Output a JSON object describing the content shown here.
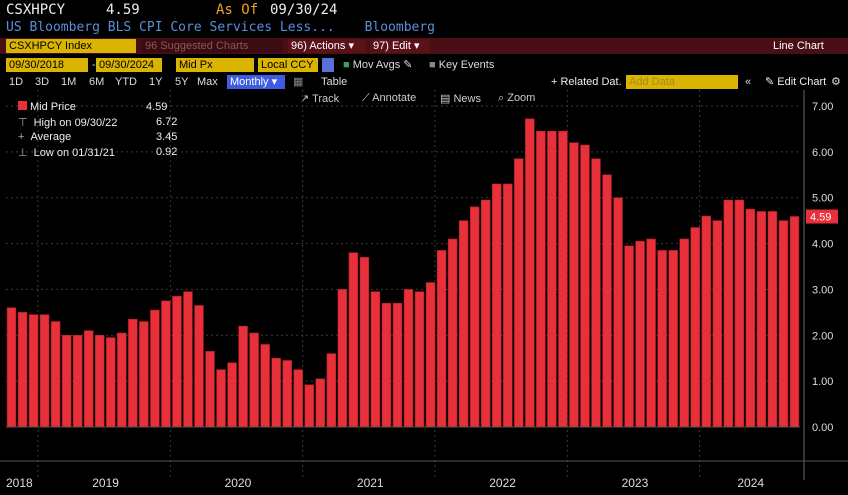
{
  "header": {
    "ticker": "CSXHPCY",
    "last_value": "4.59",
    "as_of_label": "As Of",
    "as_of_date": "09/30/24",
    "description": "US Bloomberg BLS CPI Core Services Less...",
    "source": "Bloomberg"
  },
  "toolbar": {
    "security": "CSXHPCY Index",
    "suggested": "96 Suggested Charts",
    "actions": "96) Actions ▾",
    "edit": "97) Edit ▾",
    "chart_type": "Line Chart",
    "start_date": "09/30/2018",
    "end_date": "09/30/2024",
    "field": "Mid Px",
    "currency": "Local CCY",
    "mov_avgs": "Mov Avgs",
    "key_events": "Key Events",
    "periods": [
      "1D",
      "3D",
      "1M",
      "6M",
      "YTD",
      "1Y",
      "5Y",
      "Max"
    ],
    "frequency": "Monthly ▾",
    "table": "Table",
    "related_data": "+ Related Dat.",
    "add_data_placeholder": "Add Data",
    "collapse": "«",
    "edit_chart": "Edit Chart",
    "settings": "⚙",
    "track": "Track",
    "annotate": "Annotate",
    "news": "News",
    "zoom": "Zoom"
  },
  "legend": {
    "mid_price_label": "Mid Price",
    "mid_price_value": "4.59",
    "high_label": "High on 09/30/22",
    "high_value": "6.72",
    "average_label": "Average",
    "average_value": "3.45",
    "low_label": "Low on 01/31/21",
    "low_value": "0.92"
  },
  "colors": {
    "bar": "#e8303a",
    "bar_dark": "#b31d28",
    "accent": "#d9b400",
    "background": "#000000",
    "grid": "#3a3a3a"
  },
  "chart_data": {
    "type": "bar",
    "frequency": "monthly",
    "ylim": [
      0,
      7
    ],
    "yticks": [
      "0.00",
      "1.00",
      "2.00",
      "3.00",
      "4.00",
      "5.00",
      "6.00",
      "7.00"
    ],
    "last_label": "4.59",
    "year_labels": [
      "2018",
      "2019",
      "2020",
      "2021",
      "2022",
      "2023",
      "2024"
    ],
    "categories": [
      "2018-10",
      "2018-11",
      "2018-12",
      "2019-01",
      "2019-02",
      "2019-03",
      "2019-04",
      "2019-05",
      "2019-06",
      "2019-07",
      "2019-08",
      "2019-09",
      "2019-10",
      "2019-11",
      "2019-12",
      "2020-01",
      "2020-02",
      "2020-03",
      "2020-04",
      "2020-05",
      "2020-06",
      "2020-07",
      "2020-08",
      "2020-09",
      "2020-10",
      "2020-11",
      "2020-12",
      "2021-01",
      "2021-02",
      "2021-03",
      "2021-04",
      "2021-05",
      "2021-06",
      "2021-07",
      "2021-08",
      "2021-09",
      "2021-10",
      "2021-11",
      "2021-12",
      "2022-01",
      "2022-02",
      "2022-03",
      "2022-04",
      "2022-05",
      "2022-06",
      "2022-07",
      "2022-08",
      "2022-09",
      "2022-10",
      "2022-11",
      "2022-12",
      "2023-01",
      "2023-02",
      "2023-03",
      "2023-04",
      "2023-05",
      "2023-06",
      "2023-07",
      "2023-08",
      "2023-09",
      "2023-10",
      "2023-11",
      "2023-12",
      "2024-01",
      "2024-02",
      "2024-03",
      "2024-04",
      "2024-05",
      "2024-06",
      "2024-07",
      "2024-08",
      "2024-09"
    ],
    "values": [
      2.6,
      2.5,
      2.45,
      2.45,
      2.3,
      2.0,
      2.0,
      2.1,
      2.0,
      1.95,
      2.05,
      2.35,
      2.3,
      2.55,
      2.75,
      2.85,
      2.95,
      2.65,
      1.65,
      1.25,
      1.4,
      2.2,
      2.05,
      1.8,
      1.5,
      1.45,
      1.25,
      0.92,
      1.05,
      1.6,
      3.0,
      3.8,
      3.7,
      2.95,
      2.7,
      2.7,
      3.0,
      2.95,
      3.15,
      3.85,
      4.1,
      4.5,
      4.8,
      4.95,
      5.3,
      5.3,
      5.85,
      6.72,
      6.45,
      6.45,
      6.45,
      6.2,
      6.15,
      5.85,
      5.5,
      5.0,
      3.95,
      4.05,
      4.1,
      3.85,
      3.85,
      4.1,
      4.35,
      4.6,
      4.5,
      4.95,
      4.95,
      4.75,
      4.7,
      4.7,
      4.5,
      4.59
    ]
  }
}
